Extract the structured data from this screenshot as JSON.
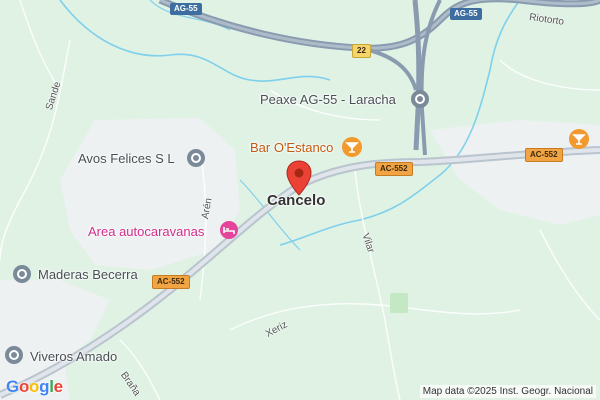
{
  "map": {
    "town": "Cancelo",
    "pois": {
      "peaxe": "Peaxe AG-55 - Laracha",
      "bar": "Bar O'Estanco",
      "avos": "Avos Felices S L",
      "area": "Area autocaravanas",
      "maderas": "Maderas Becerra",
      "viveros": "Viveros Amado"
    },
    "streets": {
      "sande": "Sande",
      "aren": "Arén",
      "vilar": "Vilar",
      "xeriz": "Xeriz",
      "brana": "Braña",
      "riotorto": "Riotorto"
    },
    "road_shields": {
      "ag55_a": "AG-55",
      "ag55_b": "AG-55",
      "r22": "22",
      "ac552_a": "AC-552",
      "ac552_b": "AC-552",
      "ac552_c": "AC-552"
    },
    "attribution": "Map data ©2025 Inst. Geogr. Nacional",
    "logo": {
      "G": "G",
      "o1": "o",
      "o2": "o",
      "g": "g",
      "l": "l",
      "e": "e"
    },
    "colors": {
      "land": "#dff2e4",
      "urban": "#f1f3f4",
      "water": "#7fd0ec",
      "main_road": "#b9c4cf",
      "motorway": "#8a9bb0",
      "marker": "#ea4335",
      "poi_orange": "#f29a2e",
      "poi_pink": "#e4459a",
      "poi_gray": "#7b8a99"
    },
    "icons": {
      "marker": "map-pin",
      "bar": "cocktail-glass",
      "bar_right": "cocktail-glass",
      "area": "bed",
      "generic": "location-circle"
    }
  }
}
